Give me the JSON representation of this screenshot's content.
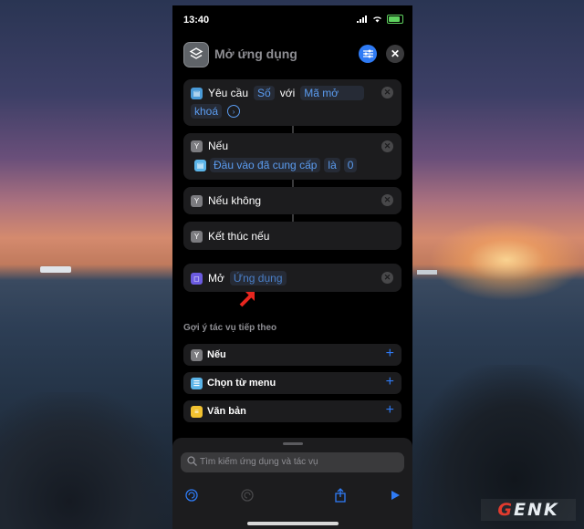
{
  "status": {
    "time": "13:40"
  },
  "header": {
    "title": "Mở ứng dụng"
  },
  "actions": {
    "request": {
      "label": "Yêu cầu",
      "type_chip": "Số",
      "with_label": "với",
      "prompt_chip_line1": "Mã mở",
      "prompt_chip_line2": "khoá"
    },
    "if": {
      "label": "Nếu",
      "input_chip": "Đầu vào đã cung cấp",
      "is_label": "là",
      "value_chip": "0"
    },
    "otherwise": {
      "label": "Nếu không"
    },
    "end_if": {
      "label": "Kết thúc nếu"
    },
    "open": {
      "label": "Mở",
      "app_chip": "Ứng dụng"
    }
  },
  "suggestions": {
    "title": "Gợi ý tác vụ tiếp theo",
    "items": [
      {
        "label": "Nếu",
        "icon": "branch-icon"
      },
      {
        "label": "Chọn từ menu",
        "icon": "menu-icon"
      },
      {
        "label": "Văn bản",
        "icon": "text-icon"
      }
    ]
  },
  "bottom": {
    "search_placeholder": "Tìm kiếm ứng dụng và tác vụ"
  },
  "watermark": {
    "prefix": "G",
    "suffix": "ENK"
  },
  "colors": {
    "accent": "#2f7bf5",
    "chip_text": "#5b9cf0",
    "card_bg": "#1c1c1e"
  }
}
